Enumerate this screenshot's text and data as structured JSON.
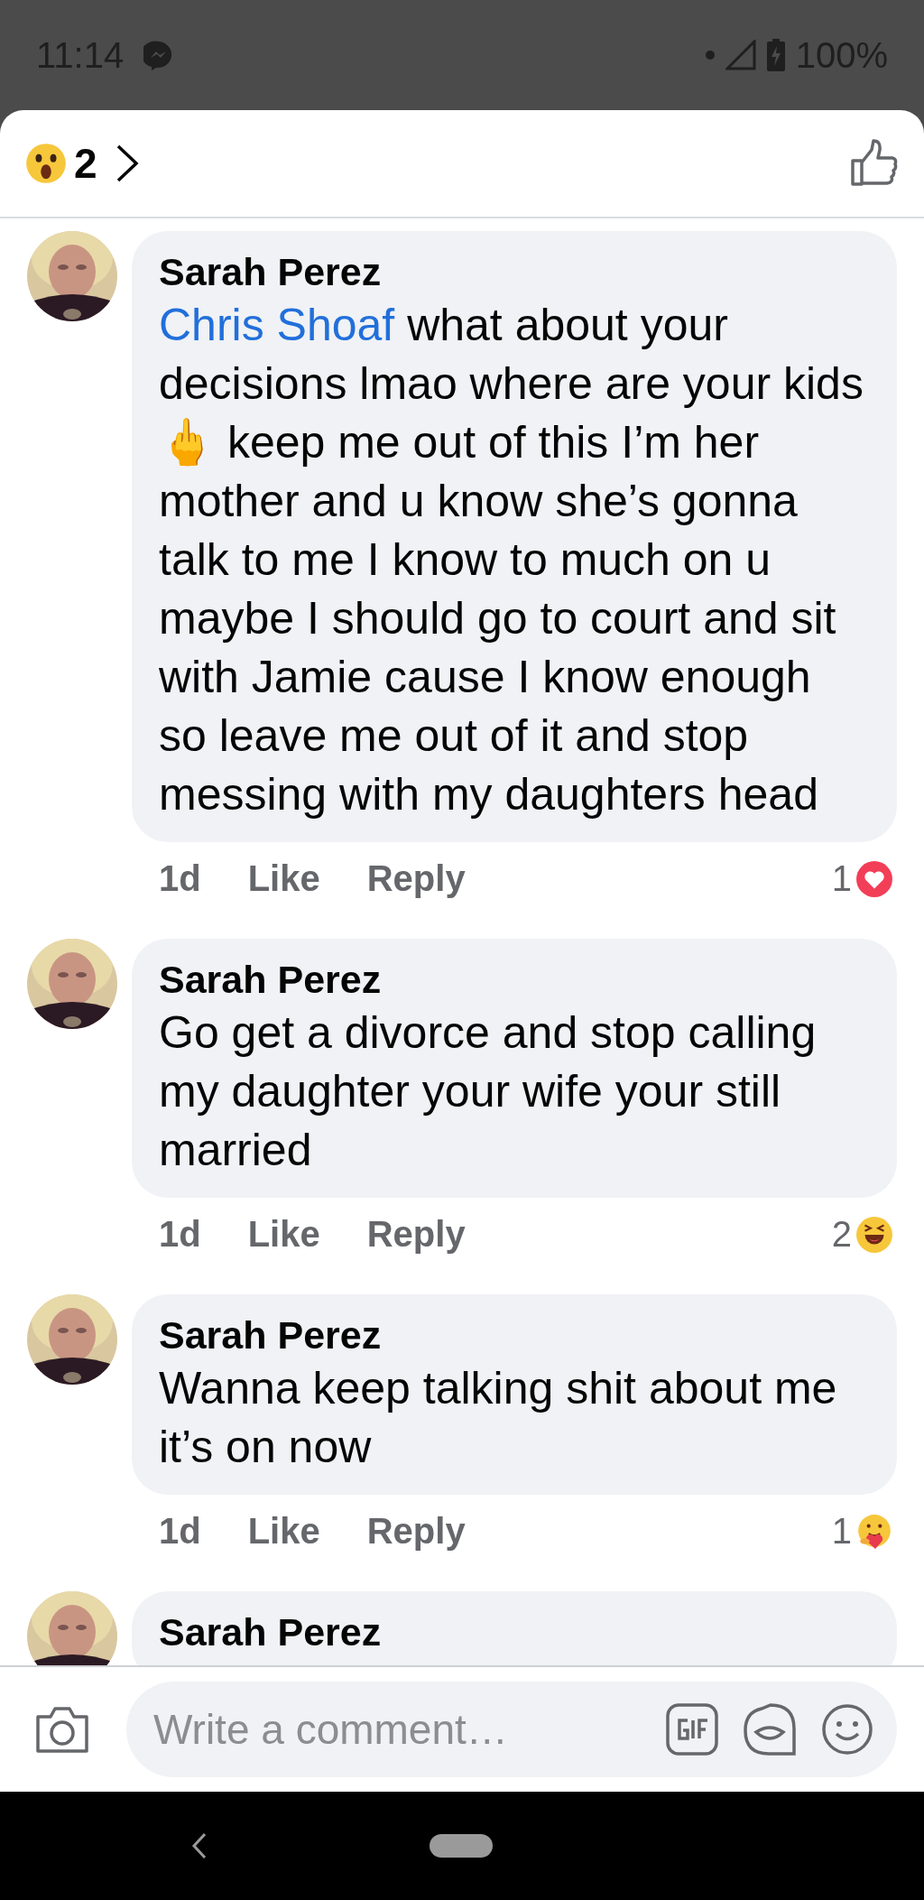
{
  "status_bar": {
    "time": "11:14",
    "battery": "100%"
  },
  "header": {
    "reaction": {
      "kind": "wow"
    },
    "count": "2"
  },
  "comments": [
    {
      "author": "Sarah Perez",
      "mention": "Chris Shoaf",
      "text": " what about your decisions lmao where are your kids 🖕 keep me out of this I’m her mother and u know she’s gonna talk to me I know to much on u maybe I should go to court and sit with Jamie cause I know enough so leave me out of it and stop messing with my daughters head",
      "time": "1d",
      "like": "Like",
      "reply": "Reply",
      "reaction_count": "1",
      "reaction": {
        "kind": "love"
      }
    },
    {
      "author": "Sarah Perez",
      "text": "Go get a divorce and stop calling my daughter your wife your still married",
      "time": "1d",
      "like": "Like",
      "reply": "Reply",
      "reaction_count": "2",
      "reaction": {
        "kind": "haha"
      }
    },
    {
      "author": "Sarah Perez",
      "text": "Wanna keep talking shit about me it’s on now",
      "time": "1d",
      "like": "Like",
      "reply": "Reply",
      "reaction_count": "1",
      "reaction": {
        "kind": "care"
      }
    },
    {
      "author": "Sarah Perez"
    }
  ],
  "composer": {
    "placeholder": "Write a comment…"
  }
}
